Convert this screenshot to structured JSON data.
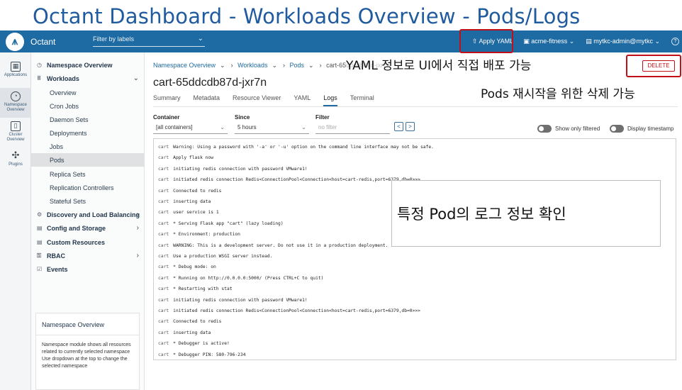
{
  "slide": {
    "title": "Octant Dashboard - Workloads Overview - Pods/Logs"
  },
  "topbar": {
    "brand": "Octant",
    "filter_placeholder": "Filter by labels",
    "apply_yaml": "Apply YAML",
    "namespace": "acme-fitness",
    "context": "mytkc-admin@mytkc",
    "help": "?"
  },
  "rail": [
    {
      "label": "Applications",
      "icon": "grid-icon"
    },
    {
      "label": "Namespace Overview",
      "icon": "gauge-icon"
    },
    {
      "label": "Cluster Overview",
      "icon": "cluster-icon"
    },
    {
      "label": "Plugins",
      "icon": "puzzle-icon"
    }
  ],
  "sidebar": {
    "items": [
      {
        "label": "Namespace Overview",
        "type": "top",
        "glyph": "◷"
      },
      {
        "label": "Workloads",
        "type": "top",
        "glyph": "⠿",
        "arrow": "⌄"
      },
      {
        "label": "Overview",
        "type": "sub"
      },
      {
        "label": "Cron Jobs",
        "type": "sub"
      },
      {
        "label": "Daemon Sets",
        "type": "sub"
      },
      {
        "label": "Deployments",
        "type": "sub"
      },
      {
        "label": "Jobs",
        "type": "sub"
      },
      {
        "label": "Pods",
        "type": "sub",
        "selected": true
      },
      {
        "label": "Replica Sets",
        "type": "sub"
      },
      {
        "label": "Replication Controllers",
        "type": "sub"
      },
      {
        "label": "Stateful Sets",
        "type": "sub"
      },
      {
        "label": "Discovery and Load Balancing",
        "type": "top",
        "glyph": "⚙",
        "arrow": "›"
      },
      {
        "label": "Config and Storage",
        "type": "top",
        "glyph": "▤",
        "arrow": "›"
      },
      {
        "label": "Custom Resources",
        "type": "top",
        "glyph": "▤"
      },
      {
        "label": "RBAC",
        "type": "top",
        "glyph": "⚿",
        "arrow": "›"
      },
      {
        "label": "Events",
        "type": "top",
        "glyph": "☑"
      }
    ],
    "card": {
      "title": "Namespace Overview",
      "body": "Namespace module shows all resources related to currently selected namespace Use dropdown at the top to change the selected namespace"
    }
  },
  "main": {
    "breadcrumb": [
      "Namespace Overview",
      "Workloads",
      "Pods",
      "cart-65ddcdb87d-jxr7n"
    ],
    "pod_name": "cart-65ddcdb87d-jxr7n",
    "delete_label": "DELETE",
    "tabs": [
      "Summary",
      "Metadata",
      "Resource Viewer",
      "YAML",
      "Logs",
      "Terminal"
    ],
    "active_tab": "Logs",
    "container": {
      "label": "Container",
      "value": "[all containers]"
    },
    "since": {
      "label": "Since",
      "value": "5 hours"
    },
    "filter": {
      "label": "Filter",
      "placeholder": "no filter"
    },
    "toggle_filtered": "Show only filtered",
    "toggle_timestamp": "Display timestamp",
    "logs": [
      {
        "c": "cart",
        "t": "Warning: Using a password with '-a' or '-u' option on the command line interface may not be safe."
      },
      {
        "c": "cart",
        "t": "Apply flask now"
      },
      {
        "c": "cart",
        "t": "initiating redis connection with password VMware1!"
      },
      {
        "c": "cart",
        "t": "initiated redis connection Redis<ConnectionPool<Connection<host=cart-redis,port=6379,db=0>>>"
      },
      {
        "c": "cart",
        "t": "Connected to redis"
      },
      {
        "c": "cart",
        "t": "inserting data"
      },
      {
        "c": "cart",
        "t": "user service is 1"
      },
      {
        "c": "cart",
        "t": "* Serving Flask app \"cart\" (lazy loading)"
      },
      {
        "c": "cart",
        "t": "* Environment: production"
      },
      {
        "c": "cart",
        "t": "WARNING: This is a development server. Do not use it in a production deployment."
      },
      {
        "c": "cart",
        "t": "Use a production WSGI server instead."
      },
      {
        "c": "cart",
        "t": "* Debug mode: on"
      },
      {
        "c": "cart",
        "t": "* Running on http://0.0.0.0:5000/ (Press CTRL+C to quit)"
      },
      {
        "c": "cart",
        "t": "* Restarting with stat"
      },
      {
        "c": "cart",
        "t": "initiating redis connection with password VMware1!"
      },
      {
        "c": "cart",
        "t": "initiated redis connection Redis<ConnectionPool<Connection<host=cart-redis,port=6379,db=0>>>"
      },
      {
        "c": "cart",
        "t": "Connected to redis"
      },
      {
        "c": "cart",
        "t": "inserting data"
      },
      {
        "c": "cart",
        "t": "* Debugger is active!"
      },
      {
        "c": "cart",
        "t": "* Debugger PIN: 580-796-234"
      }
    ]
  },
  "annotations": {
    "yaml_note": "YAML 정보로 UI에서 직접 배포 가능",
    "delete_note": "Pods 재시작을 위한 삭제 가능",
    "log_note": "특정 Pod의 로그 정보 확인"
  },
  "colors": {
    "nav": "#1e6aa2",
    "title": "#1f5b9e",
    "highlight": "#c0101a"
  }
}
